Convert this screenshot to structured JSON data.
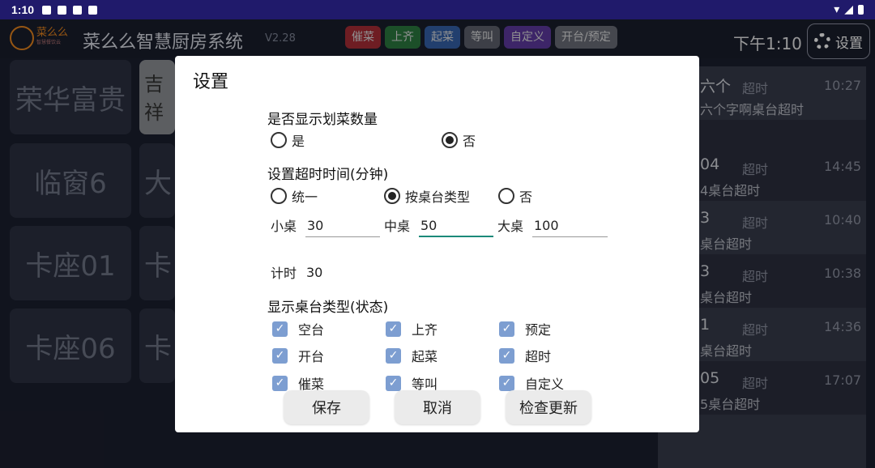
{
  "statusbar": {
    "time": "1:10"
  },
  "header": {
    "logo_text": "菜么么",
    "logo_sub": "智慧餐饮云",
    "app_title": "菜么么智慧厨房系统",
    "version": "V2.28",
    "chips": [
      {
        "label": "催菜",
        "color": "#c2303a"
      },
      {
        "label": "上齐",
        "color": "#2e8b43"
      },
      {
        "label": "起菜",
        "color": "#3a6fc0"
      },
      {
        "label": "等叫",
        "color": "#6a6f7a"
      },
      {
        "label": "自定义",
        "color": "#6a3fb5"
      },
      {
        "label": "开台/预定",
        "color": "#7a7d86"
      }
    ],
    "clock": "下午1:10",
    "settings_label": "设置"
  },
  "tables": {
    "col1": [
      "荣华富贵",
      "临窗6",
      "卡座01",
      "卡座06"
    ],
    "col2": [
      "吉祥",
      "大",
      "卡",
      "卡"
    ]
  },
  "orders": [
    {
      "name": "六个",
      "status": "超时",
      "time": "10:27",
      "desc": "六个字啊桌台超时"
    },
    {
      "name": "04",
      "status": "超时",
      "time": "14:45",
      "desc": "4桌台超时"
    },
    {
      "name": "3",
      "status": "超时",
      "time": "10:40",
      "desc": "桌台超时"
    },
    {
      "name": "3",
      "status": "超时",
      "time": "10:38",
      "desc": "桌台超时"
    },
    {
      "name": "1",
      "status": "超时",
      "time": "14:36",
      "desc": "桌台超时"
    },
    {
      "name": "05",
      "status": "超时",
      "time": "17:07",
      "desc": "5桌台超时"
    }
  ],
  "dialog": {
    "title": "设置",
    "show_count": {
      "label": "是否显示划菜数量",
      "opt_yes": "是",
      "opt_no": "否",
      "selected": "否"
    },
    "timeout": {
      "label": "设置超时时间(分钟)",
      "opt_unified": "统一",
      "opt_by_type": "按桌台类型",
      "opt_no": "否",
      "selected": "按桌台类型",
      "small_label": "小桌",
      "small_value": "30",
      "medium_label": "中桌",
      "medium_value": "50",
      "large_label": "大桌",
      "large_value": "100",
      "timer_label": "计时",
      "timer_value": "30"
    },
    "display_types": {
      "label": "显示桌台类型(状态)",
      "items": [
        "空台",
        "上齐",
        "预定",
        "开台",
        "起菜",
        "超时",
        "催菜",
        "等叫",
        "自定义"
      ]
    },
    "buttons": {
      "save": "保存",
      "cancel": "取消",
      "check_update": "检查更新"
    }
  }
}
